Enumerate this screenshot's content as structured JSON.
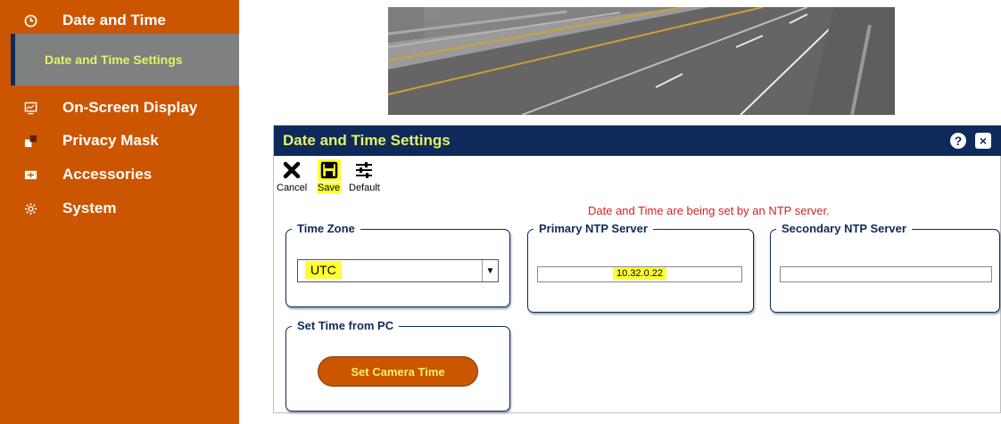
{
  "sidebar": {
    "items": [
      {
        "label": "Date and Time",
        "icon": "clock-icon"
      },
      {
        "label": "On-Screen Display",
        "icon": "monitor-icon"
      },
      {
        "label": "Privacy Mask",
        "icon": "mask-icon"
      },
      {
        "label": "Accessories",
        "icon": "accessories-icon"
      },
      {
        "label": "System",
        "icon": "gear-icon"
      }
    ],
    "sub_item": {
      "label": "Date and Time Settings",
      "active": true
    }
  },
  "dialog": {
    "title": "Date and Time Settings",
    "help_icon": "?",
    "close_icon": "×",
    "toolbar": {
      "cancel_label": "Cancel",
      "save_label": "Save",
      "default_label": "Default"
    },
    "notice": "Date and Time are being set by an NTP server.",
    "time_zone": {
      "legend": "Time Zone",
      "value": "UTC"
    },
    "primary_ntp": {
      "legend": "Primary NTP Server",
      "value": "10.32.0.22"
    },
    "secondary_ntp": {
      "legend": "Secondary NTP Server",
      "value": ""
    },
    "set_time": {
      "legend": "Set Time from PC",
      "button_label": "Set Camera Time"
    }
  },
  "colors": {
    "sidebar_bg": "#cc5500",
    "active_sub_bg": "#7f8080",
    "titlebar_bg": "#0e2a5a",
    "title_text": "#e6f266",
    "notice_text": "#d62020",
    "highlight": "#ffff33"
  }
}
